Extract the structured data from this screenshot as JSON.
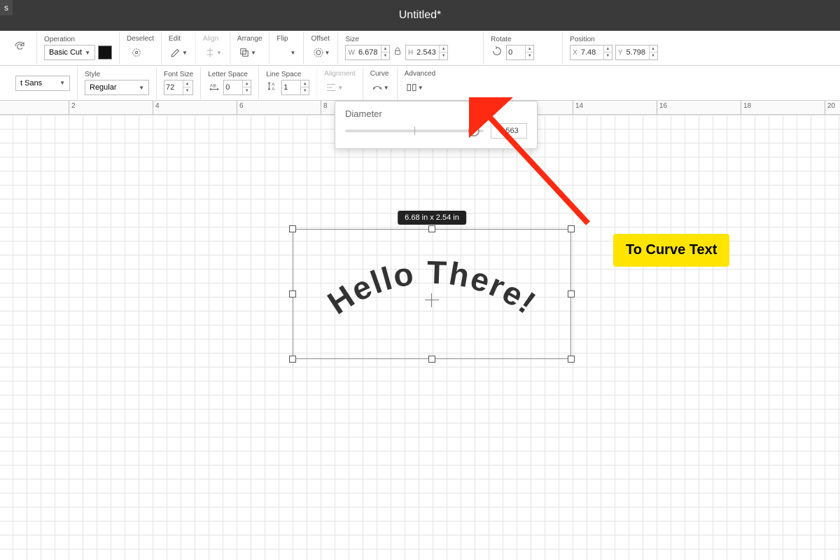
{
  "title": "Untitled*",
  "tab_corner": "s",
  "toolbar1": {
    "operation": {
      "label": "Operation",
      "value": "Basic Cut"
    },
    "deselect": "Deselect",
    "edit": "Edit",
    "align": "Align",
    "arrange": "Arrange",
    "flip": "Flip",
    "offset": "Offset",
    "size": {
      "label": "Size",
      "w": "6.678",
      "h": "2.543"
    },
    "rotate": {
      "label": "Rotate",
      "value": "0"
    },
    "position": {
      "label": "Position",
      "x": "7.48",
      "y": "5.798"
    }
  },
  "toolbar2": {
    "font": {
      "label": "Font",
      "value": "t Sans"
    },
    "style": {
      "label": "Style",
      "value": "Regular"
    },
    "fontsize": {
      "label": "Font Size",
      "value": "72"
    },
    "letterspace": {
      "label": "Letter Space",
      "value": "0"
    },
    "linespace": {
      "label": "Line Space",
      "value": "1"
    },
    "alignment": "Alignment",
    "curve": "Curve",
    "advanced": "Advanced"
  },
  "popover": {
    "title": "Diameter",
    "value": "5.563"
  },
  "ruler": [
    "2",
    "4",
    "6",
    "8",
    "14",
    "16",
    "18",
    "20"
  ],
  "canvas": {
    "dim_badge": "6.68  in x 2.54  in",
    "text": "Hello There!"
  },
  "annotation": "To Curve Text",
  "w_prefix": "W",
  "h_prefix": "H",
  "x_prefix": "X",
  "y_prefix": "Y"
}
